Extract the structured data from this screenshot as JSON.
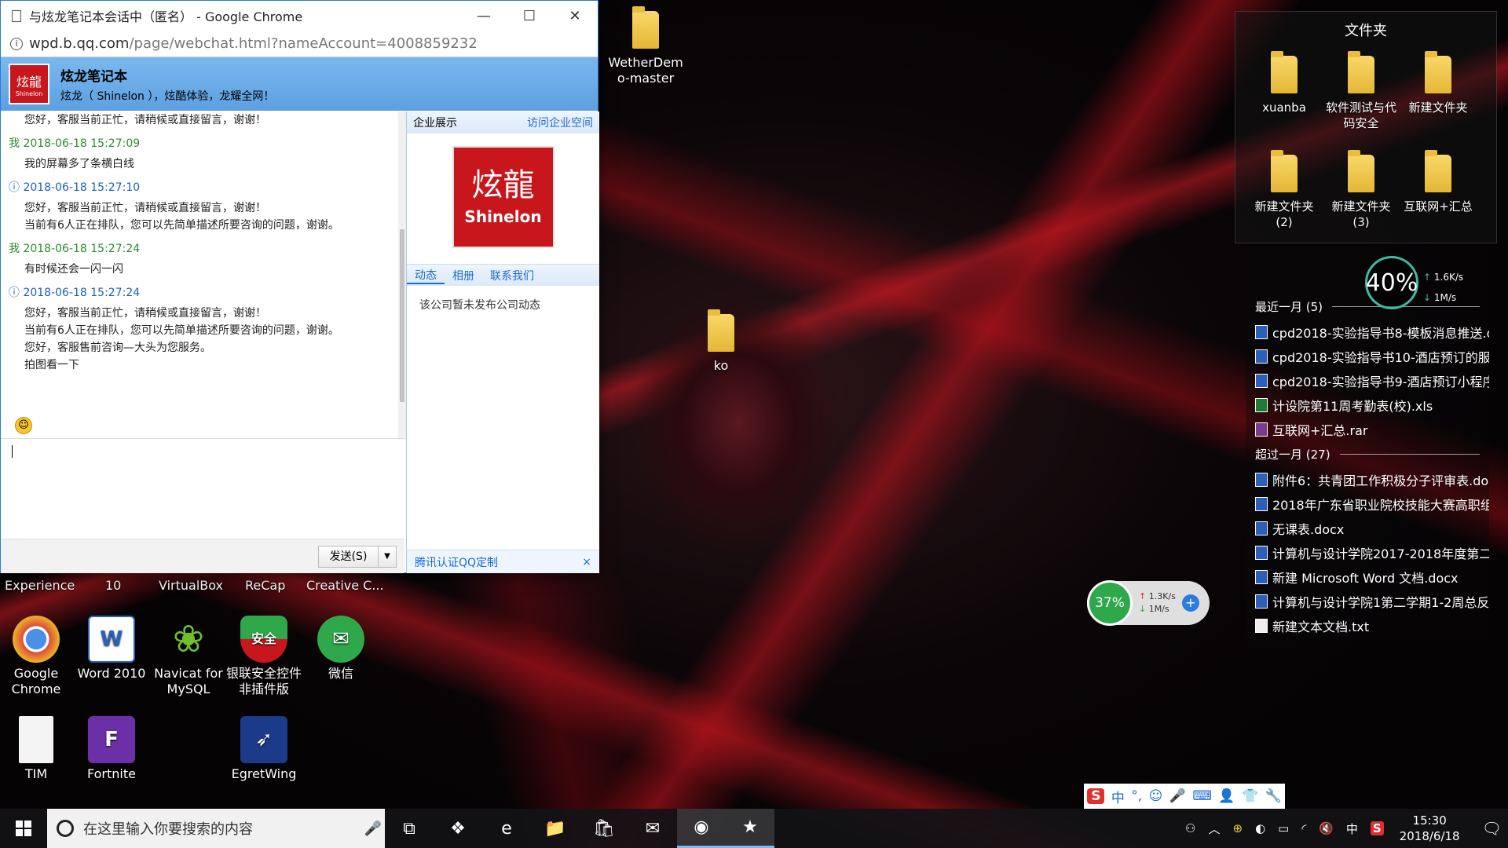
{
  "window": {
    "title": "与炫龙笔记本会话中（匿名） - Google Chrome",
    "url_host": "wpd.b.qq.com",
    "url_path": "/page/webchat.html?nameAccount=4008859232",
    "minimize": "—",
    "maximize": "☐",
    "close": "✕"
  },
  "qq": {
    "company_name": "炫龙笔记本",
    "slogan": "炫龙（ Shinelon ），炫酷体验，龙耀全网！",
    "logo_cn": "炫龍",
    "logo_en": "Shinelon",
    "messages": [
      {
        "type": "text",
        "lines": [
          "您好，客服当前正忙，请稍候或直接留言，谢谢！"
        ]
      },
      {
        "type": "me",
        "header": "我 2018-06-18 15:27:09",
        "lines": [
          "我的屏幕多了条横白线"
        ]
      },
      {
        "type": "sys",
        "header": "2018-06-18 15:27:10",
        "lines": [
          "您好，客服当前正忙，请稍候或直接留言，谢谢！",
          "当前有6人正在排队，您可以先简单描述所要咨询的问题，谢谢。"
        ]
      },
      {
        "type": "me",
        "header": "我 2018-06-18 15:27:24",
        "lines": [
          "有时候还会一闪一闪"
        ]
      },
      {
        "type": "sys",
        "header": "2018-06-18 15:27:24",
        "lines": [
          "您好，客服当前正忙，请稍候或直接留言，谢谢！",
          "当前有6人正在排队，您可以先简单描述所要咨询的问题，谢谢。",
          "您好，客服售前咨询—大头为您服务。",
          "拍图看一下"
        ]
      }
    ],
    "send_label": "发送(S)",
    "side_title": "企业展示",
    "side_link": "访问企业空间",
    "tabs": [
      "动态",
      "相册",
      "联系我们"
    ],
    "no_news": "该公司暂未发布公司动态",
    "footer_link": "腾讯认证QQ定制",
    "footer_close": "×"
  },
  "desktop": {
    "partial_labels": [
      "Experience",
      "10",
      "VirtualBox",
      "ReCap",
      "Creative C..."
    ],
    "icons_row1": [
      {
        "label": "Google Chrome",
        "glyph": "◉",
        "color": "#e04a3a"
      },
      {
        "label": "Word 2010",
        "glyph": "W",
        "color": "#2b5fb8"
      },
      {
        "label": "Navicat for MySQL",
        "glyph": "❀",
        "color": "#6fbf2e"
      },
      {
        "label": "银联安全控件非插件版",
        "glyph": "安全",
        "color": "#c8161d"
      },
      {
        "label": "微信",
        "glyph": "✉",
        "color": "#2ea84a"
      }
    ],
    "icons_row2": [
      {
        "label": "TIM",
        "glyph": "",
        "color": "#f0f0f0"
      },
      {
        "label": "Fortnite",
        "glyph": "F",
        "color": "#6b2fa8"
      },
      {
        "label": "EgretWing",
        "glyph": "➶",
        "color": "#1b3a8a"
      }
    ],
    "folder_top": "WetherDemo-master",
    "folder_mid": "ko"
  },
  "fence": {
    "title": "文件夹",
    "items": [
      "xuanba",
      "软件测试与代码安全",
      "新建文件夹",
      "新建文件夹 (2)",
      "新建文件夹 (3)",
      "互联网+汇总"
    ]
  },
  "gauge": {
    "percent": "40%",
    "up": "1.6K/s",
    "down": "1M/s"
  },
  "recent": {
    "group1": "最近一月 (5)",
    "group1_items": [
      {
        "name": "cpd2018-实验指导书8-模板消息推送.d",
        "kind": "doc"
      },
      {
        "name": "cpd2018-实验指导书10-酒店预订的服...",
        "kind": "doc"
      },
      {
        "name": "cpd2018-实验指导书9-酒店预订小程序...",
        "kind": "doc"
      },
      {
        "name": "计设院第11周考勤表(校).xls",
        "kind": "xls"
      },
      {
        "name": "互联网+汇总.rar",
        "kind": "rar"
      }
    ],
    "group2": "超过一月 (27)",
    "group2_items": [
      {
        "name": "附件6：共青团工作积极分子评审表.doc",
        "kind": "doc"
      },
      {
        "name": "2018年广东省职业院校技能大赛高职组...",
        "kind": "doc"
      },
      {
        "name": "无课表.docx",
        "kind": "doc"
      },
      {
        "name": "计算机与设计学院2017-2018年度第二...",
        "kind": "doc"
      },
      {
        "name": "新建 Microsoft Word 文档.docx",
        "kind": "doc"
      },
      {
        "name": "计算机与设计学院1第二学期1-2周总反...",
        "kind": "doc"
      },
      {
        "name": "新建文本文档.txt",
        "kind": "txt"
      }
    ]
  },
  "speed": {
    "percent": "37%",
    "up": "1.3K/s",
    "down": "1M/s"
  },
  "ime": {
    "logo": "S",
    "items": [
      "中",
      "°,",
      "☺",
      "🎤",
      "⌨",
      "👤",
      "👕",
      "🔧"
    ]
  },
  "taskbar": {
    "search_placeholder": "在这里输入你要搜索的内容",
    "apps": [
      "⧉",
      "❖",
      "e",
      "📁",
      "🛍",
      "✉",
      "◉",
      "★"
    ],
    "tray": [
      "⚇",
      "︿",
      "⊕",
      "◐",
      "▭",
      "◜",
      "🔇",
      "中",
      "S"
    ],
    "time": "15:30",
    "date": "2018/6/18",
    "notify": "🗨"
  }
}
